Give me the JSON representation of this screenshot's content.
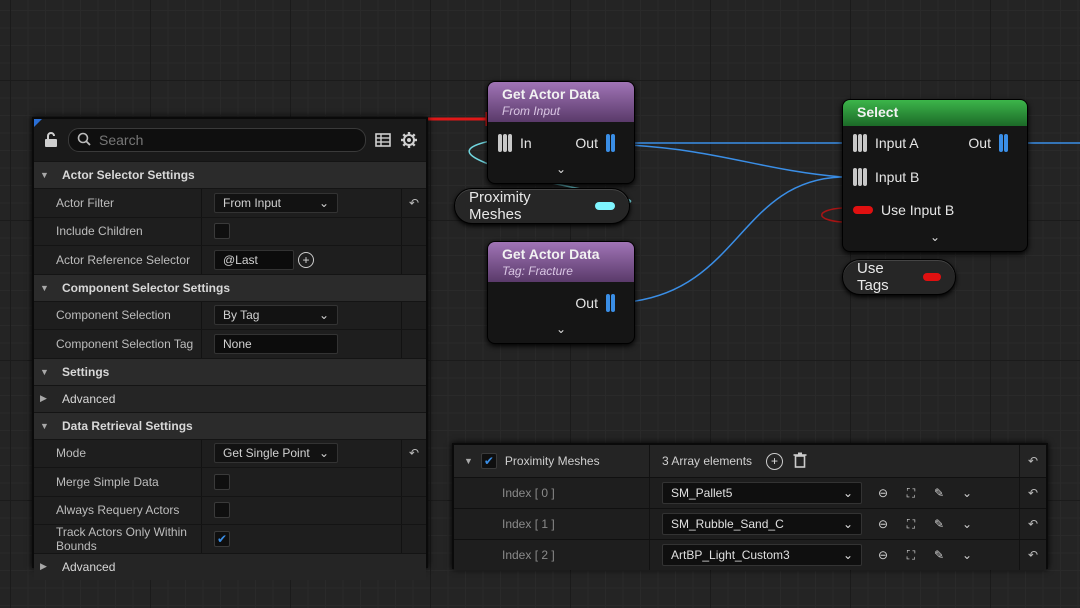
{
  "details_panel": {
    "search_placeholder": "Search",
    "categories": {
      "actor_selector": "Actor Selector Settings",
      "component_selector": "Component Selector Settings",
      "settings": "Settings",
      "advanced": "Advanced",
      "data_retrieval": "Data Retrieval Settings",
      "advanced2": "Advanced"
    },
    "rows": {
      "actor_filter": {
        "label": "Actor Filter",
        "value": "From Input"
      },
      "include_children": {
        "label": "Include Children",
        "checked": false
      },
      "actor_reference_selector": {
        "label": "Actor Reference Selector",
        "value": "@Last"
      },
      "component_selection": {
        "label": "Component Selection",
        "value": "By Tag"
      },
      "component_selection_tag": {
        "label": "Component Selection Tag",
        "value": "None"
      },
      "mode": {
        "label": "Mode",
        "value": "Get Single Point"
      },
      "merge_simple_data": {
        "label": "Merge Simple Data",
        "checked": false
      },
      "always_requery": {
        "label": "Always Requery Actors",
        "checked": false
      },
      "track_actors": {
        "label": "Track Actors Only Within Bounds",
        "checked": true
      }
    }
  },
  "nodes": {
    "get_actor_data_1": {
      "title": "Get Actor Data",
      "subtitle": "From Input",
      "in_pin": "In",
      "out_pin": "Out"
    },
    "get_actor_data_2": {
      "title": "Get Actor Data",
      "subtitle": "Tag: Fracture",
      "out_pin": "Out"
    },
    "select": {
      "title": "Select",
      "input_a": "Input A",
      "input_b": "Input B",
      "use_input_b": "Use Input B",
      "out_pin": "Out"
    },
    "proximity_meshes_var": {
      "label": "Proximity Meshes"
    },
    "use_tags_var": {
      "label": "Use Tags"
    }
  },
  "array_panel": {
    "label": "Proximity Meshes",
    "checked": true,
    "count_text": "3 Array elements",
    "elements": [
      {
        "index": "Index [ 0 ]",
        "value": "SM_Pallet5"
      },
      {
        "index": "Index [ 1 ]",
        "value": "SM_Rubble_Sand_C"
      },
      {
        "index": "Index [ 2 ]",
        "value": "ArtBP_Light_Custom3"
      }
    ]
  },
  "colors": {
    "accent_blue": "#3a8ee6",
    "node_purple": "#a074b6",
    "node_green": "#3cb54a",
    "wire_blue": "#3a8ee6",
    "wire_cyan": "#7ff5ff",
    "bool_red": "#e01010",
    "highlight_red": "#e01818"
  }
}
